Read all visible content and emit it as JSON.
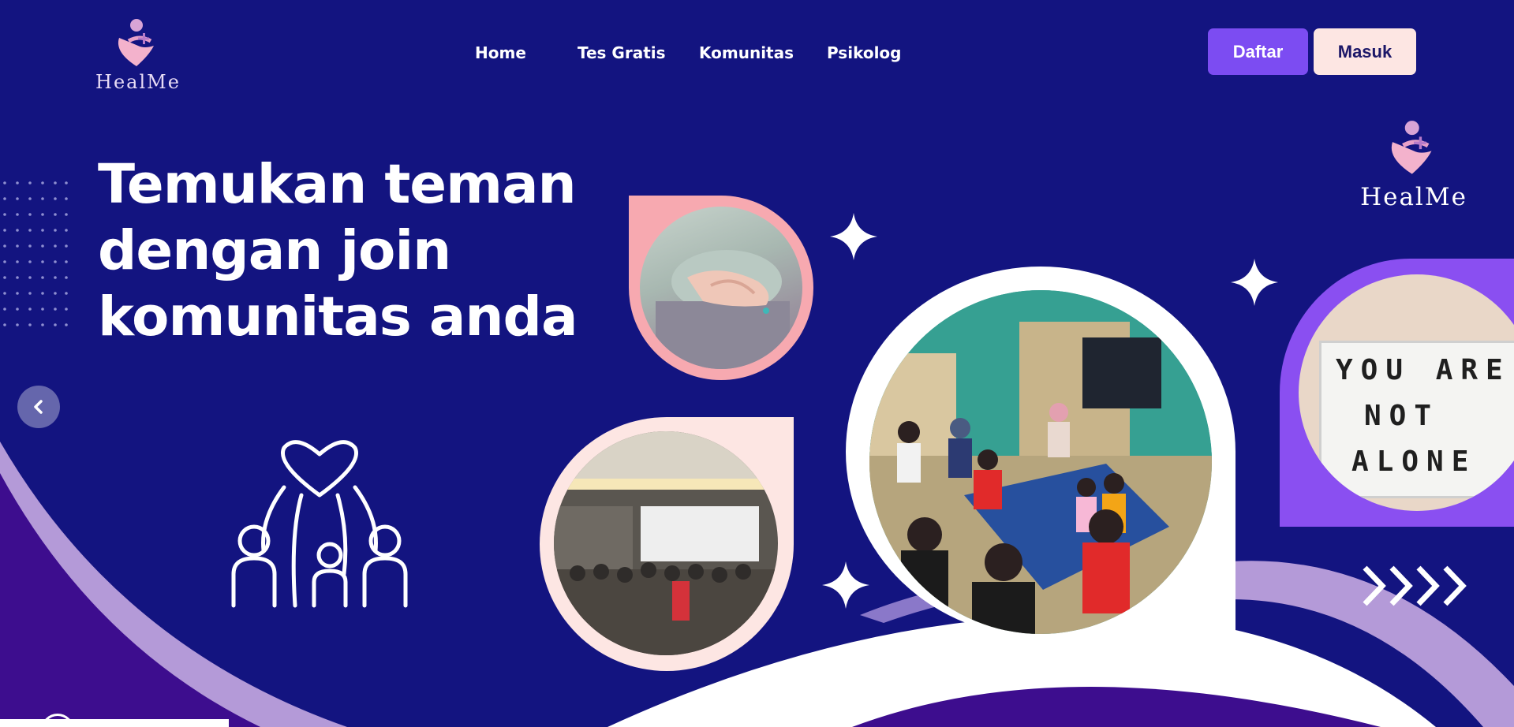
{
  "brand": {
    "name": "HealMe",
    "logo_icon": "heart-plus-icon"
  },
  "nav": {
    "items": [
      {
        "label": "Home"
      },
      {
        "label": "Tes Gratis"
      },
      {
        "label": "Komunitas"
      },
      {
        "label": "Psikolog"
      }
    ]
  },
  "auth": {
    "register_label": "Daftar",
    "login_label": "Masuk"
  },
  "hero": {
    "title_line1": "Temukan teman",
    "title_line2": "dengan join",
    "title_line3": "komunitas anda"
  },
  "slides": {
    "prev_icon": "chevron-left-icon",
    "next_icon": "chevron-right-icon"
  },
  "photos": {
    "sign_line1": "YOU ARE",
    "sign_line2": "NOT",
    "sign_line3": "ALONE"
  },
  "colors": {
    "background": "#131480",
    "accent_purple": "#7c4cf2",
    "cream": "#fde6e3",
    "pink": "#f7a9b0",
    "lavender": "#b8a1de"
  }
}
